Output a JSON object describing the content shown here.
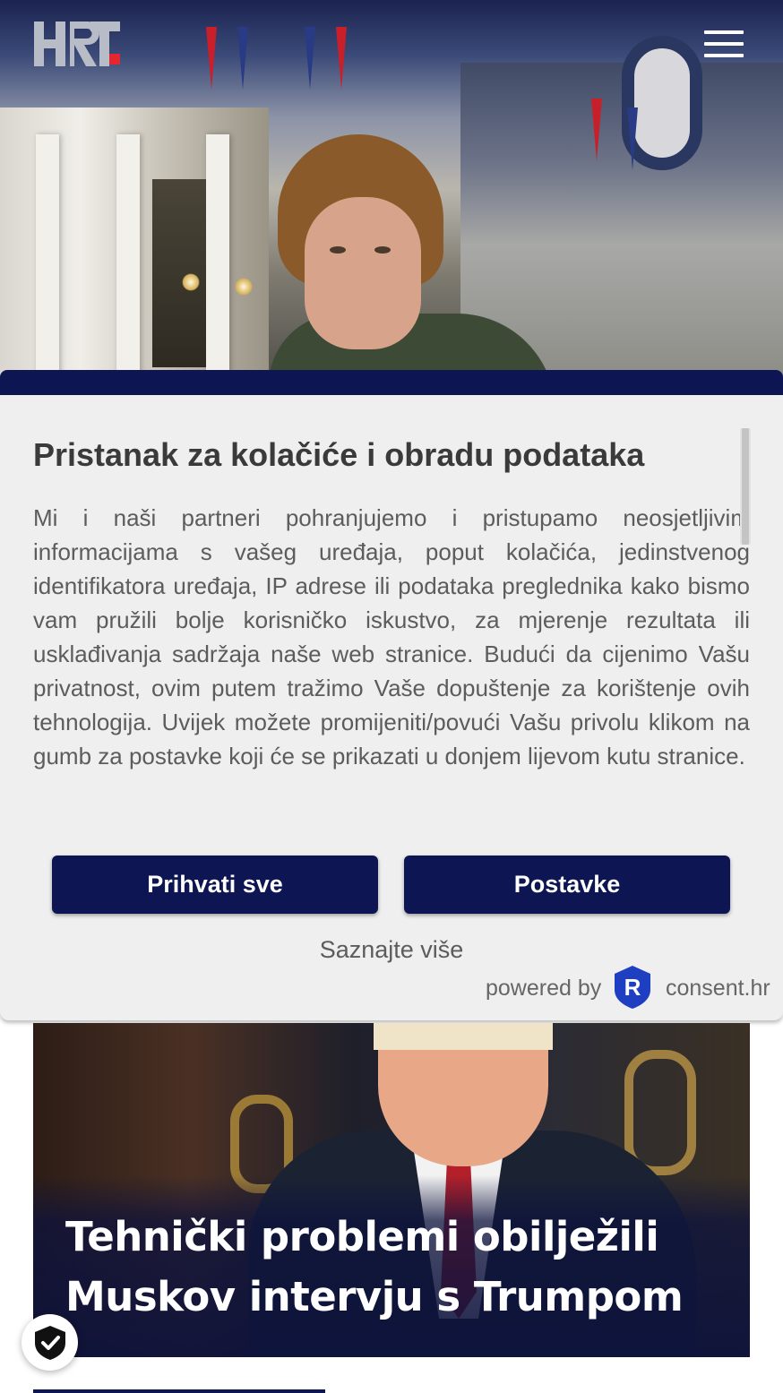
{
  "header": {
    "logo_text": "HRT",
    "menu_icon": "hamburger-menu-icon"
  },
  "consent": {
    "title": "Pristanak za kolačiće i obradu podataka",
    "body": "Mi i naši partneri pohranjujemo i pristupamo neosjetljivim informacijama s vašeg uređaja, poput kolačića, jedinstvenog identifikatora uređaja, IP adrese ili podataka preglednika kako bismo vam pružili bolje korisničko iskustvo, za mjerenje rezultata ili usklađivanja sadržaja naše web stranice. Budući da cijenimo Vašu privatnost, ovim putem tražimo Vaše dopuštenje za korištenje ovih tehnologija. Uvijek možete promijeniti/povući Vašu privolu klikom na gumb za postavke koji će se prikazati u donjem lijevom kutu stranice.",
    "accept_label": "Prihvati sve",
    "settings_label": "Postavke",
    "learn_more_label": "Saznajte više",
    "powered_by_label": "powered by",
    "provider_logo_letter": "R",
    "provider_name": "consent.hr"
  },
  "article": {
    "title": "Tehnički problemi obilježili Muskov intervju s Trumpom"
  },
  "colors": {
    "brand_navy": "#0d1652",
    "logo_red": "#e3262f",
    "logo_grey": "#b8bcc6",
    "modal_bg": "#efefef",
    "text_grey": "#5c5c5c",
    "provider_blue": "#1f3fc2"
  },
  "icons": {
    "badge": "shield-check-icon",
    "provider": "consent-r-logo-icon"
  }
}
